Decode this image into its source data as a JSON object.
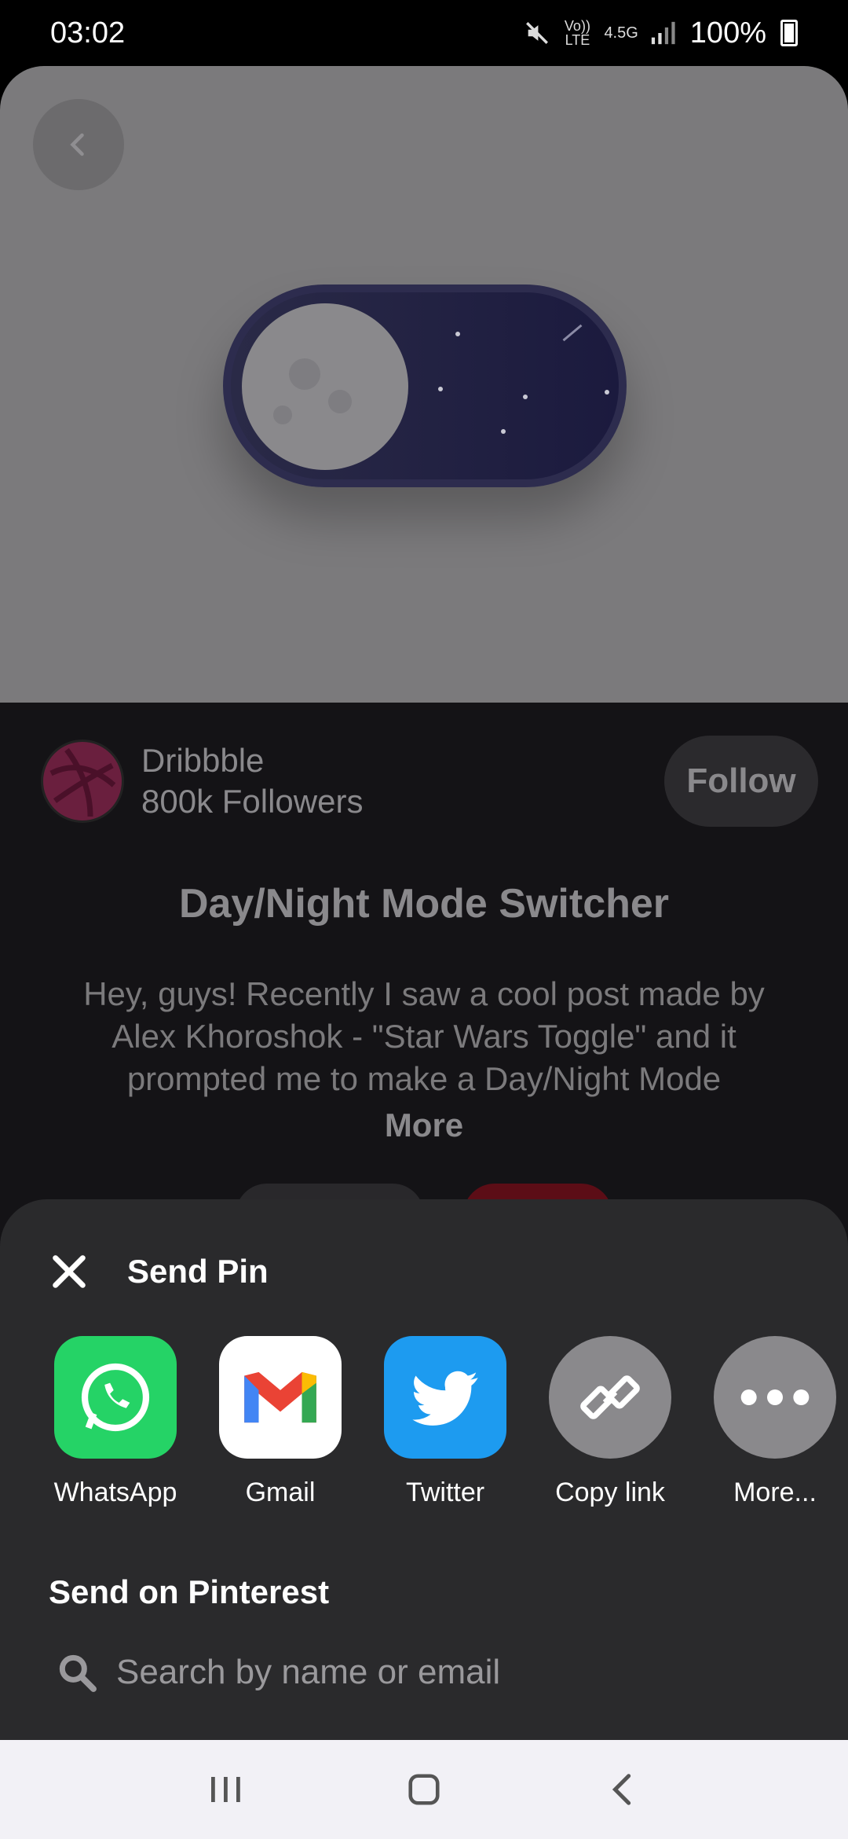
{
  "status_bar": {
    "time": "03:02",
    "network_label_top": "Vo)) LTE",
    "network_label_data": "4.5G",
    "battery": "100%"
  },
  "creator": {
    "name": "Dribbble",
    "followers": "800k Followers",
    "follow_label": "Follow"
  },
  "pin": {
    "title": "Day/Night Mode Switcher",
    "description": "Hey, guys! Recently I saw a cool post made by Alex Khoroshok - \"Star Wars Toggle\" and it prompted me to make a Day/Night Mode",
    "more_label": "More"
  },
  "share_sheet": {
    "title": "Send Pin",
    "apps": [
      {
        "label": "WhatsApp",
        "icon": "whatsapp-icon",
        "color": "#25d366"
      },
      {
        "label": "Gmail",
        "icon": "gmail-icon",
        "color": "#ffffff"
      },
      {
        "label": "Twitter",
        "icon": "twitter-icon",
        "color": "#1d9bf0"
      },
      {
        "label": "Copy link",
        "icon": "link-icon",
        "color": "#8a898c"
      },
      {
        "label": "More...",
        "icon": "more-icon",
        "color": "#8a898c"
      }
    ],
    "section_title": "Send on Pinterest",
    "search_placeholder": "Search by name or email"
  }
}
